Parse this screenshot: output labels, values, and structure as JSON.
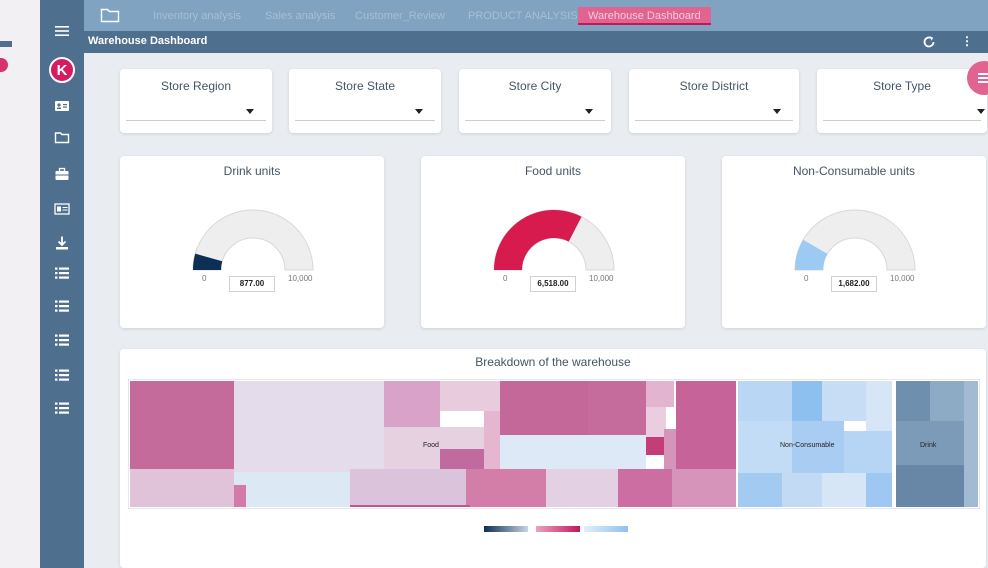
{
  "tabs": [
    "Inventory analysis",
    "Sales analysis",
    "Customer_Review",
    "PRODUCT ANALYSIS",
    "Warehouse Dashboard"
  ],
  "active_tab": "Warehouse Dashboard",
  "page_title": "Warehouse Dashboard",
  "filters": [
    "Store Region",
    "Store State",
    "Store City",
    "Store District",
    "Store Type"
  ],
  "gauges": [
    {
      "title": "Drink units",
      "value": 877,
      "value_label": "877.00",
      "min": "0",
      "max": "10,000",
      "color": "#0d2e55",
      "max_value": 10000
    },
    {
      "title": "Food units",
      "value": 6518,
      "value_label": "6,518.00",
      "min": "0",
      "max": "10,000",
      "color": "#d81b4e",
      "max_value": 10000
    },
    {
      "title": "Non-Consumable units",
      "value": 1682,
      "value_label": "1,682.00",
      "min": "0",
      "max": "10,000",
      "color": "#9ccaf2",
      "max_value": 10000
    }
  ],
  "treemap": {
    "title": "Breakdown of the warehouse",
    "groups": [
      "Food",
      "Non-Consumable",
      "Drink"
    ]
  },
  "sidebar_icons": [
    "menu-icon",
    "contact-card-icon",
    "folder-icon",
    "briefcase-icon",
    "id-card-icon",
    "download-icon",
    "list-icon",
    "list-icon",
    "list-icon",
    "list-icon",
    "list-icon"
  ],
  "colors": {
    "sidebar": "#4e6f8e",
    "tabbar": "#7fa3c0",
    "accent": "#e0648f",
    "food": "#c2185b",
    "drink": "#0d2e55",
    "non_consumable": "#9ccaf2"
  }
}
